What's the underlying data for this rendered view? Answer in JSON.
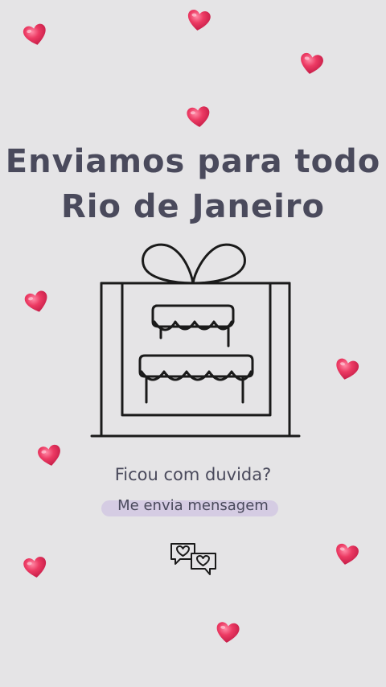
{
  "title": {
    "line1": "Enviamos para todo",
    "line2": "Rio de Janeiro"
  },
  "question": "Ficou com duvida?",
  "cta": {
    "label": "Me envia mensagem"
  },
  "icons": {
    "illustration": "gift-box-cake-icon",
    "chat": "chat-hearts-icon",
    "decoration": "heart-icon"
  },
  "colors": {
    "background": "#e5e4e6",
    "text": "#4a4a5c",
    "heart": "#e8345e",
    "cta_highlight": "#d5cce3"
  }
}
